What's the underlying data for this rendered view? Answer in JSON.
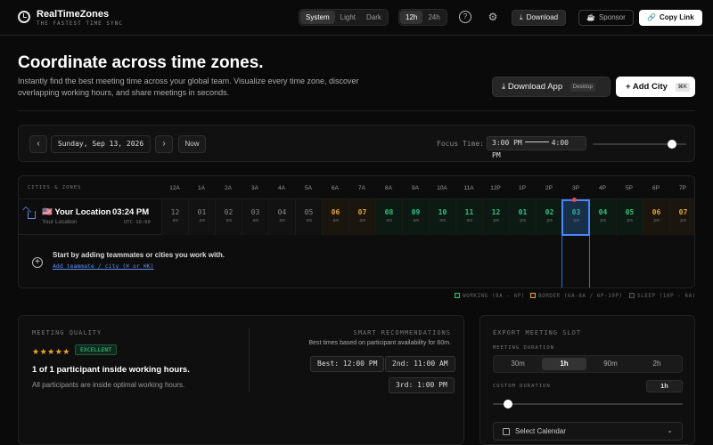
{
  "app": {
    "title": "RealTimeZones",
    "subtitle": "THE FASTEST TIME SYNC"
  },
  "header": {
    "theme_options": [
      "System",
      "Light",
      "Dark"
    ],
    "theme_selected": "System",
    "format_options": [
      "12h",
      "24h"
    ],
    "format_selected": "12h",
    "help_icon": "?",
    "settings_icon": "⚙",
    "download_label": "Download",
    "sponsor_label": "Sponsor",
    "copy_link_label": "Copy Link"
  },
  "hero": {
    "title": "Coordinate across time zones.",
    "description": "Instantly find the best meeting time across your global team. Visualize every time zone, discover overlapping working hours, and share meetings in seconds.",
    "download_app_label": "Download App",
    "download_app_tag": "Desktop",
    "add_city_label": "Add City",
    "add_city_shortcut": "⌘K"
  },
  "datebar": {
    "prev": "‹",
    "next": "›",
    "date": "Sunday, Sep 13, 2026",
    "now_label": "Now",
    "focus_label": "Focus Time:",
    "focus_start": "3:00 PM",
    "focus_end": "4:00 PM",
    "slider_value": 0.85
  },
  "grid": {
    "cities_label": "CITIES & ZONES",
    "hours": [
      "12A",
      "1A",
      "2A",
      "3A",
      "4A",
      "5A",
      "6A",
      "7A",
      "8A",
      "9A",
      "10A",
      "11A",
      "12P",
      "1P",
      "2P",
      "3P",
      "4P",
      "5P",
      "6P",
      "7P"
    ],
    "location": {
      "flag": "🇺🇸",
      "name": "Your Location",
      "sub": "Your Location",
      "time": "03:24 PM",
      "utc": "UTC-10:00",
      "cells": [
        {
          "h": "12",
          "ap": "am",
          "type": "sleep"
        },
        {
          "h": "01",
          "ap": "am",
          "type": "sleep"
        },
        {
          "h": "02",
          "ap": "am",
          "type": "sleep"
        },
        {
          "h": "03",
          "ap": "am",
          "type": "sleep"
        },
        {
          "h": "04",
          "ap": "am",
          "type": "sleep"
        },
        {
          "h": "05",
          "ap": "am",
          "type": "sleep"
        },
        {
          "h": "06",
          "ap": "am",
          "type": "border"
        },
        {
          "h": "07",
          "ap": "am",
          "type": "border"
        },
        {
          "h": "08",
          "ap": "am",
          "type": "work"
        },
        {
          "h": "09",
          "ap": "am",
          "type": "work"
        },
        {
          "h": "10",
          "ap": "am",
          "type": "work"
        },
        {
          "h": "11",
          "ap": "am",
          "type": "work"
        },
        {
          "h": "12",
          "ap": "pm",
          "type": "work"
        },
        {
          "h": "01",
          "ap": "pm",
          "type": "work"
        },
        {
          "h": "02",
          "ap": "pm",
          "type": "work"
        },
        {
          "h": "03",
          "ap": "pm",
          "type": "work"
        },
        {
          "h": "04",
          "ap": "pm",
          "type": "work"
        },
        {
          "h": "05",
          "ap": "pm",
          "type": "work"
        },
        {
          "h": "06",
          "ap": "pm",
          "type": "border"
        },
        {
          "h": "07",
          "ap": "pm",
          "type": "border"
        }
      ]
    },
    "add_text": "Start by adding teammates or cities you work with.",
    "add_link": "Add teammate / city (⌘ or ⌘K)"
  },
  "legend": {
    "working": "WORKING (8A - 6P)",
    "border": "BORDER (6A-8A / 6P-10P)",
    "sleep": "SLEEP (10P - 6A)"
  },
  "colors": {
    "working": "#2ec27e",
    "border": "#e6a33a",
    "sleep": "#8a8a8a",
    "focus": "#4a86ff"
  },
  "meeting_quality": {
    "label": "MEETING QUALITY",
    "stars": "★★★★★",
    "rating": "EXCELLENT",
    "headline": "1 of 1 participant inside working hours.",
    "sub": "All participants are inside optimal working hours."
  },
  "smart_recommendations": {
    "label": "SMART RECOMMENDATIONS",
    "sub": "Best times based on participant availability for 60m.",
    "best": "Best: 12:00 PM",
    "second": "2nd: 11:00 AM",
    "third": "3rd: 1:00 PM"
  },
  "export": {
    "label": "EXPORT MEETING SLOT",
    "duration_label": "MEETING DURATION",
    "durations": [
      "30m",
      "1h",
      "90m",
      "2h"
    ],
    "duration_selected": "1h",
    "custom_label": "CUSTOM DURATION",
    "custom_value": "1h",
    "custom_slider_value": 0.08,
    "calendar_label": "Select Calendar"
  }
}
